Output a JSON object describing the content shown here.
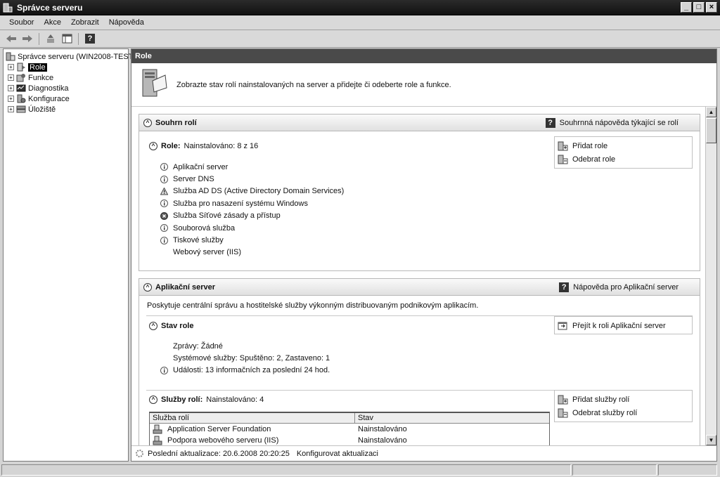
{
  "window": {
    "title": "Správce serveru"
  },
  "menu": [
    "Soubor",
    "Akce",
    "Zobrazit",
    "Nápověda"
  ],
  "toolbar": {
    "icons": [
      "back-icon",
      "forward-icon",
      "up-icon",
      "show-hide-tree-icon",
      "help-icon"
    ],
    "help_glyph": "?"
  },
  "tree": {
    "root": "Správce serveru (WIN2008-TEST)",
    "items": [
      {
        "label": "Role",
        "icon": "roles-icon",
        "selected": true
      },
      {
        "label": "Funkce",
        "icon": "features-icon"
      },
      {
        "label": "Diagnostika",
        "icon": "diagnostics-icon"
      },
      {
        "label": "Konfigurace",
        "icon": "configuration-icon"
      },
      {
        "label": "Úložiště",
        "icon": "storage-icon"
      }
    ]
  },
  "content": {
    "header": "Role",
    "intro": "Zobrazte stav rolí nainstalovaných na server a přidejte či odeberte role a funkce.",
    "summary": {
      "title": "Souhrn rolí",
      "help": "Souhrnná nápověda týkající se rolí",
      "roles_label": "Role:",
      "roles_count": "Nainstalováno: 8 z 16",
      "actions": [
        "Přidat role",
        "Odebrat role"
      ],
      "roles": [
        {
          "label": "Aplikační server",
          "status": "info"
        },
        {
          "label": "Server DNS",
          "status": "info"
        },
        {
          "label": "Služba AD DS (Active Directory Domain Services)",
          "status": "warning"
        },
        {
          "label": "Služba pro nasazení systému Windows",
          "status": "info"
        },
        {
          "label": "Služba Síťové zásady a přístup",
          "status": "error"
        },
        {
          "label": "Souborová služba",
          "status": "info"
        },
        {
          "label": "Tiskové služby",
          "status": "info"
        },
        {
          "label": "Webový server (IIS)",
          "status": "none"
        }
      ]
    },
    "app_server": {
      "title": "Aplikační server",
      "help": "Nápověda pro Aplikační server",
      "description": "Poskytuje centrální správu a hostitelské služby výkonným distribuovaným podnikovým aplikacím.",
      "status_title": "Stav role",
      "goto_action": "Přejít k roli Aplikační server",
      "status_lines": [
        {
          "label": "Zprávy: Žádné",
          "status": "none"
        },
        {
          "label": "Systémové služby: Spuštěno: 2, Zastaveno: 1",
          "status": "none"
        },
        {
          "label": "Události: 13 informačních za poslední 24 hod.",
          "status": "info"
        }
      ],
      "services_label": "Služby rolí:",
      "services_count": "Nainstalováno: 4",
      "service_actions": [
        "Přidat služby rolí",
        "Odebrat služby rolí"
      ],
      "table": {
        "headers": [
          "Služba rolí",
          "Stav"
        ],
        "rows": [
          [
            "Application Server Foundation",
            "Nainstalováno"
          ],
          [
            "Podpora webového serveru (IIS)",
            "Nainstalováno"
          ]
        ]
      }
    },
    "last_update": "Poslední aktualizace: 20.6.2008 20:20:25",
    "configure_link": "Konfigurovat aktualizaci"
  },
  "window_buttons": [
    "_",
    "□",
    "×"
  ],
  "collapse_glyph": "^",
  "expand_glyph": "+"
}
